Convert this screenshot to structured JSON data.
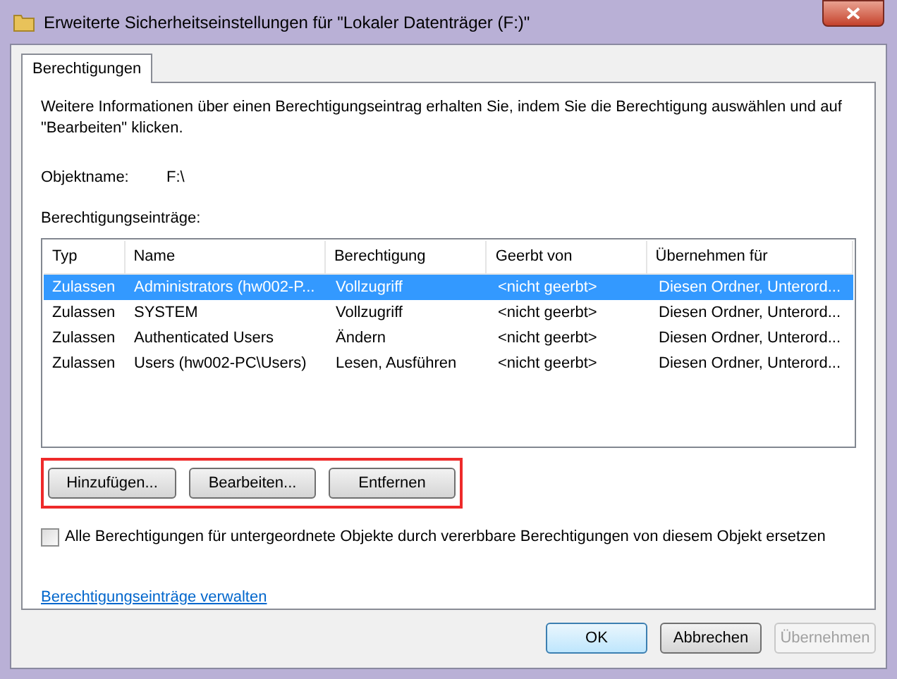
{
  "window": {
    "title": "Erweiterte Sicherheitseinstellungen für \"Lokaler Datenträger (F:)\""
  },
  "tabs": [
    {
      "label": "Berechtigungen",
      "selected": true
    }
  ],
  "intro": "Weitere Informationen über einen Berechtigungseintrag erhalten Sie, indem Sie die Berechtigung auswählen und auf \"Bearbeiten\" klicken.",
  "object_name": {
    "label": "Objektname:",
    "value": "F:\\"
  },
  "entries_label": "Berechtigungseinträge:",
  "table": {
    "columns": [
      "Typ",
      "Name",
      "Berechtigung",
      "Geerbt von",
      "Übernehmen für"
    ],
    "rows": [
      {
        "cells": [
          "Zulassen",
          "Administrators (hw002-P...",
          "Vollzugriff",
          "<nicht geerbt>",
          "Diesen Ordner, Unterord..."
        ],
        "selected": true
      },
      {
        "cells": [
          "Zulassen",
          "SYSTEM",
          "Vollzugriff",
          "<nicht geerbt>",
          "Diesen Ordner, Unterord..."
        ],
        "selected": false
      },
      {
        "cells": [
          "Zulassen",
          "Authenticated Users",
          "Ändern",
          "<nicht geerbt>",
          "Diesen Ordner, Unterord..."
        ],
        "selected": false
      },
      {
        "cells": [
          "Zulassen",
          "Users (hw002-PC\\Users)",
          "Lesen, Ausführen",
          "<nicht geerbt>",
          "Diesen Ordner, Unterord..."
        ],
        "selected": false
      }
    ]
  },
  "entry_buttons": [
    {
      "label": "Hinzufügen..."
    },
    {
      "label": "Bearbeiten..."
    },
    {
      "label": "Entfernen"
    }
  ],
  "replace_checkbox": {
    "label": "Alle Berechtigungen für untergeordnete Objekte durch vererbbare Berechtigungen von diesem Objekt ersetzen",
    "checked": false
  },
  "manage_link": "Berechtigungseinträge verwalten",
  "footer_buttons": [
    {
      "label": "OK",
      "kind": "default",
      "disabled": false
    },
    {
      "label": "Abbrechen",
      "kind": "normal",
      "disabled": false
    },
    {
      "label": "Übernehmen",
      "kind": "normal",
      "disabled": true
    }
  ]
}
